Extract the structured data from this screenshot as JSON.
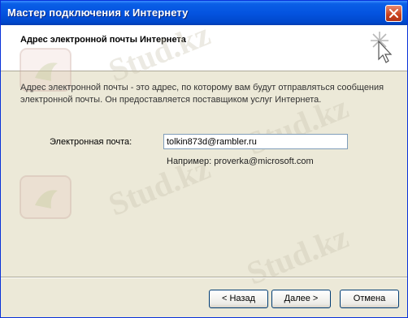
{
  "window": {
    "title": "Мастер подключения к Интернету",
    "close_icon": "close-icon"
  },
  "header": {
    "title": "Адрес электронной почты Интернета",
    "icon": "wizard-wand-icon"
  },
  "body": {
    "description": "Адрес электронной почты - это адрес, по которому вам будут отправляться сообщения электронной почты. Он предоставляется поставщиком услуг Интернета.",
    "email_label": "Электронная почта:",
    "email_value": "tolkin873d@rambler.ru",
    "example": "Например: proverka@microsoft.com"
  },
  "buttons": {
    "back": "< Назад",
    "next": "Далее >",
    "cancel": "Отмена"
  },
  "watermark": {
    "text": "Stud.kz"
  },
  "colors": {
    "titlebar": "#0454e0",
    "dialog_bg": "#ece9d8",
    "input_border": "#7f9db9"
  }
}
